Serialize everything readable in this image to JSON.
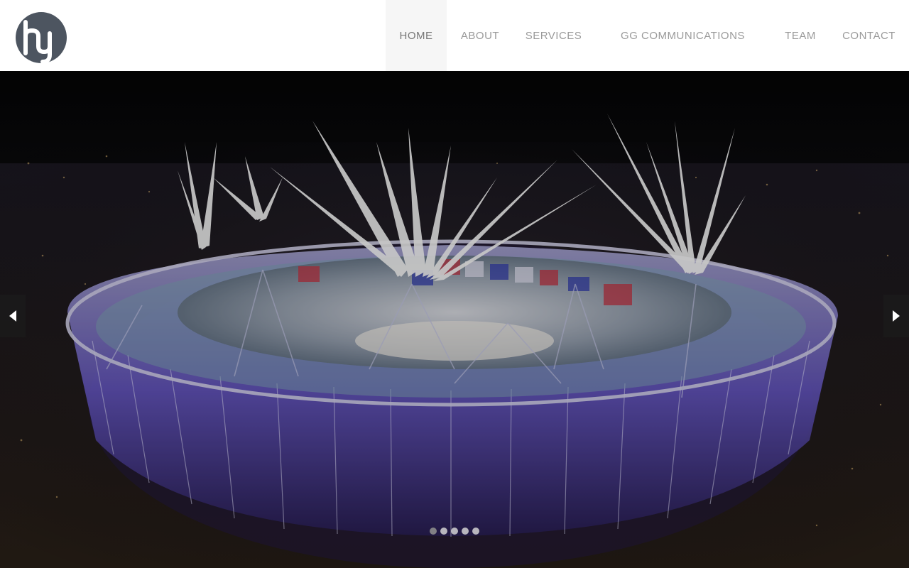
{
  "brand": {
    "logo_icon": "hy-monogram-logo"
  },
  "nav": {
    "items": [
      {
        "label": "HOME",
        "active": true
      },
      {
        "label": "ABOUT",
        "active": false
      },
      {
        "label": "SERVICES",
        "active": false
      },
      {
        "label": "GG COMMUNICATIONS",
        "active": false
      },
      {
        "label": "TEAM",
        "active": false
      },
      {
        "label": "CONTACT",
        "active": false
      }
    ]
  },
  "slider": {
    "image_subject": "stadium-fireworks-night",
    "prev_icon": "chevron-left-icon",
    "next_icon": "chevron-right-icon",
    "slide_count": 5,
    "active_slide": 1
  },
  "colors": {
    "header_bg": "#ffffff",
    "nav_text": "#9a9a9a",
    "nav_active_bg": "#f6f6f6",
    "logo": "#4d5560"
  }
}
